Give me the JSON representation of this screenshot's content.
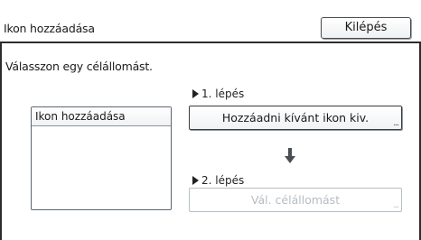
{
  "header": {
    "title": "Ikon hozzáadása",
    "exit_label": "Kilépés"
  },
  "main": {
    "instruction": "Válasszon egy célállomást.",
    "list_panel": {
      "header": "Ikon hozzáadása"
    },
    "step1": {
      "label": "1. lépés",
      "button_label": "Hozzáadni kívánt ikon kiv.",
      "button_enabled": true
    },
    "step2": {
      "label": "2. lépés",
      "button_label": "Vál. célállomást",
      "button_enabled": false
    },
    "more_indicator": "...",
    "icons": {
      "step_marker": "triangle-right-icon",
      "flow_arrow": "arrow-down-icon"
    }
  },
  "colors": {
    "border_dark": "#2c2c2c",
    "disabled_text": "#b6bcc2",
    "button_shadow": "#8e98a2"
  }
}
